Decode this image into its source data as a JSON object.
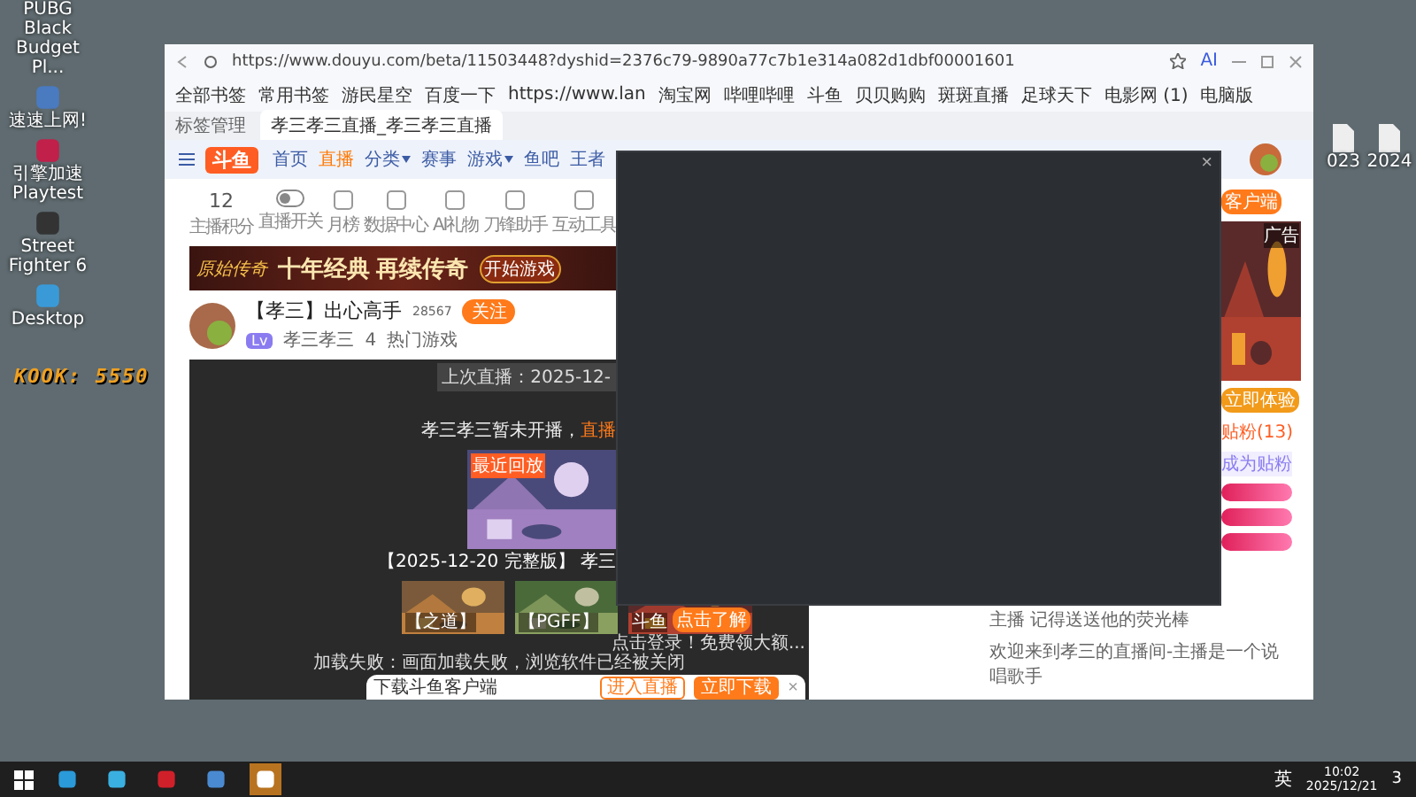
{
  "desktop": {
    "left_icons": [
      {
        "label": "PUBG Black Budget Pl..."
      },
      {
        "label": "速速上网!"
      },
      {
        "label": "引擎加速 Playtest"
      },
      {
        "label": "Street Fighter 6"
      },
      {
        "label": "Desktop"
      }
    ],
    "overlay_text": "KOOK: 5550",
    "right_icons": [
      {
        "label": "023"
      },
      {
        "label": "2024"
      }
    ]
  },
  "browser": {
    "url": "https://www.douyu.com/beta/11503448?dyshid=2376c79-9890a77c7b1e314a082d1dbf00001601",
    "ai_label": "AI",
    "bookmarks": [
      "全部书签",
      "常用书签",
      "游民星空",
      "百度一下",
      "https://www.lan",
      "淘宝网",
      "哔哩哔哩",
      "斗鱼",
      "贝贝购购",
      "斑斑直播",
      "足球天下",
      "电影网 (1)",
      "电脑版"
    ],
    "tab_manager": "标签管理",
    "tabs": [
      {
        "label": "孝三孝三直播_孝三孝三直播",
        "selected": true
      }
    ]
  },
  "page": {
    "logo": "斗鱼",
    "nav": [
      {
        "label": "首页",
        "selected": false,
        "dropdown": false
      },
      {
        "label": "直播",
        "selected": true,
        "dropdown": false
      },
      {
        "label": "分类",
        "selected": false,
        "dropdown": true
      },
      {
        "label": "赛事",
        "selected": false,
        "dropdown": false
      },
      {
        "label": "游戏",
        "selected": false,
        "dropdown": true
      },
      {
        "label": "鱼吧",
        "selected": false,
        "dropdown": false
      },
      {
        "label": "王者",
        "selected": false,
        "dropdown": false
      }
    ],
    "tools": [
      {
        "kind": "number",
        "value": "12",
        "label": "主播积分"
      },
      {
        "kind": "toggle",
        "label": "直播开关"
      },
      {
        "kind": "icon",
        "label": "月榜"
      },
      {
        "kind": "icon",
        "label": "数据中心"
      },
      {
        "kind": "icon",
        "label": "AI礼物"
      },
      {
        "kind": "icon",
        "label": "刀锋助手"
      },
      {
        "kind": "icon",
        "label": "互动工具"
      }
    ],
    "banner": {
      "logo_text": "原始传奇",
      "headline": "十年经典 再续传奇",
      "button": "开始游戏"
    },
    "streamer": {
      "name": "【孝三】出心高手",
      "followers": "28567",
      "follow_button": "关注",
      "level": "Lv",
      "nickname": "孝三孝三",
      "likes": "4",
      "category": "热门游戏"
    },
    "video": {
      "last_live": "上次直播：2025-12-",
      "offline_notice": "孝三孝三暂未开播，",
      "offline_link": "直播",
      "replay_badge": "最近回放",
      "replay_title": "【2025-12-20 完整版】 孝三",
      "clips": [
        {
          "title": "【之道】"
        },
        {
          "title": "【PGFF】"
        },
        {
          "title": "斗鱼"
        }
      ],
      "promo_button": "点击了解",
      "promo_caption": "点击登录！免费领大额...",
      "error": "加载失败：画面加载失败，浏览软件已经被关闭"
    },
    "download_bar": {
      "text": "下载斗鱼客户端",
      "buttons": [
        "进入直播",
        "立即下载"
      ],
      "close": "×"
    },
    "sidebar": {
      "client_badge": "客户端",
      "ad_label": "广告",
      "ad_button": "立即体验",
      "fans": "贴粉(13)",
      "become_fan": "成为贴粉"
    },
    "chat": [
      "主播 记得送送他的荧光棒",
      "欢迎来到孝三的直播间-主播是一个说唱歌手"
    ]
  },
  "popup": {
    "close": "×"
  },
  "taskbar": {
    "ime": "英",
    "time": "10:02",
    "date": "2025/12/21",
    "notifications": "3"
  }
}
